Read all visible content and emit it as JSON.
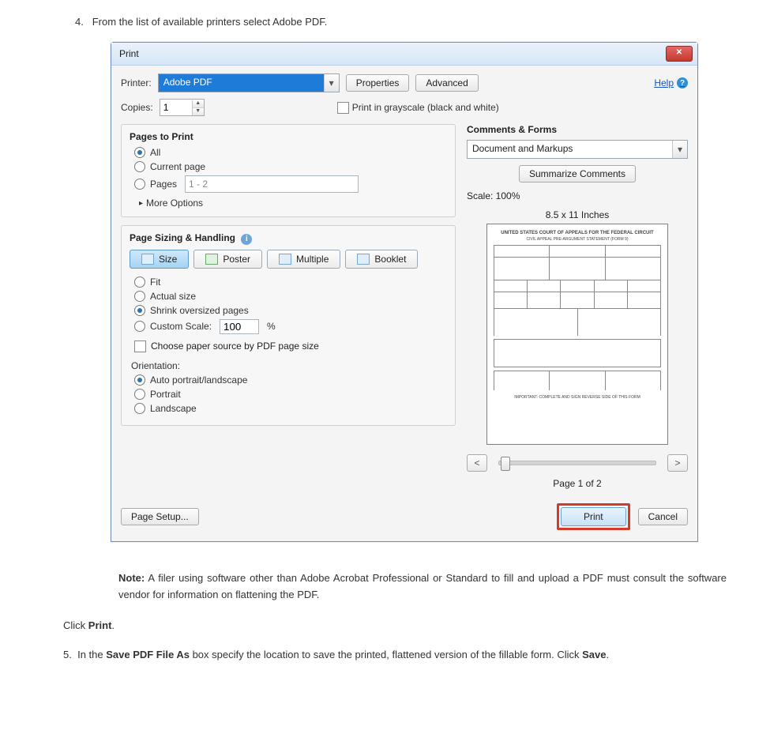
{
  "doc": {
    "step4_num": "4.",
    "step4_text": "From the list of available printers select Adobe PDF.",
    "note_label": "Note:",
    "note_text": " A filer using software other than Adobe Acrobat Professional or Standard to fill and upload a PDF must consult the software vendor for information on flattening the PDF.",
    "click_print_pre": "Click ",
    "click_print_bold": "Print",
    "step5_num": "5.",
    "step5_pre": "In the ",
    "step5_bold1": "Save PDF File As",
    "step5_mid": " box specify the location to save the printed, flattened version of the fillable form. Click ",
    "step5_bold2": "Save",
    "period": "."
  },
  "dlg": {
    "title": "Print",
    "close_glyph": "✕",
    "printer_label": "Printer:",
    "printer_value": "Adobe PDF",
    "dropdown_glyph": "▾",
    "properties": "Properties",
    "advanced": "Advanced",
    "help": "Help",
    "help_icon": "?",
    "copies_label": "Copies:",
    "copies_value": "1",
    "spin_up": "▲",
    "spin_down": "▼",
    "grayscale": "Print in grayscale (black and white)",
    "pages_title": "Pages to Print",
    "opt_all": "All",
    "opt_current": "Current page",
    "opt_pages": "Pages",
    "pages_range": "1 - 2",
    "more_options": "More Options",
    "more_tri": "▸",
    "sizing_title": "Page Sizing & Handling",
    "info_glyph": "i",
    "seg_size": "Size",
    "seg_poster": "Poster",
    "seg_multiple": "Multiple",
    "seg_booklet": "Booklet",
    "fit": "Fit",
    "actual": "Actual size",
    "shrink": "Shrink oversized pages",
    "custom_scale": "Custom Scale:",
    "custom_scale_val": "100",
    "percent": "%",
    "paper_source": "Choose paper source by PDF page size",
    "orientation": "Orientation:",
    "auto_pl": "Auto portrait/landscape",
    "portrait": "Portrait",
    "landscape": "Landscape",
    "cf_title": "Comments & Forms",
    "cf_value": "Document and Markups",
    "summarize": "Summarize Comments",
    "scale": "Scale: 100%",
    "paper_size": "8.5 x 11 Inches",
    "nav_prev": "<",
    "nav_next": ">",
    "page_indicator": "Page 1 of 2",
    "page_setup": "Page Setup...",
    "print_btn": "Print",
    "cancel_btn": "Cancel"
  }
}
